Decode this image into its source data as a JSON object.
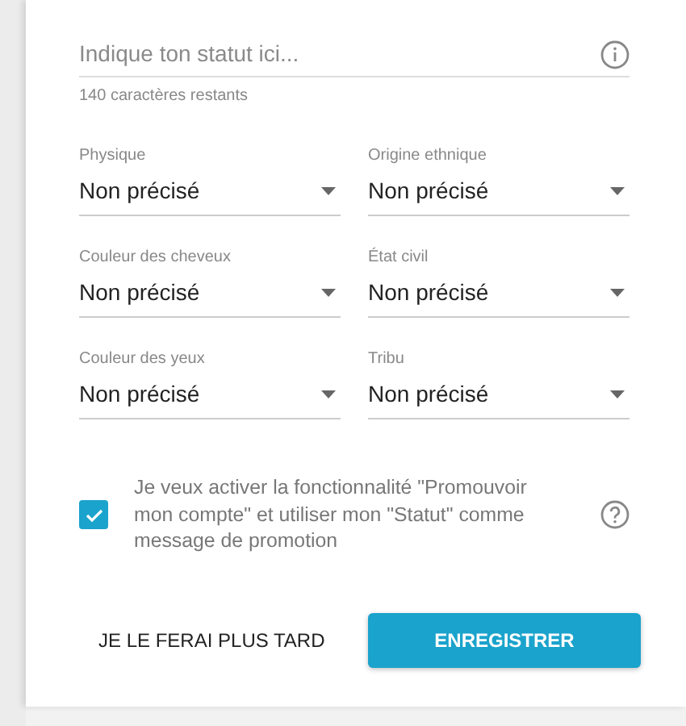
{
  "status": {
    "placeholder": "Indique ton statut ici...",
    "counter": "140 caractères restants"
  },
  "selects": [
    {
      "label": "Physique",
      "value": "Non précisé"
    },
    {
      "label": "Origine ethnique",
      "value": "Non précisé"
    },
    {
      "label": "Couleur des cheveux",
      "value": "Non précisé"
    },
    {
      "label": "État civil",
      "value": "Non précisé"
    },
    {
      "label": "Couleur des yeux",
      "value": "Non précisé"
    },
    {
      "label": "Tribu",
      "value": "Non précisé"
    }
  ],
  "promote": {
    "checked": true,
    "text": "Je veux activer la fonctionnalité \"Promouvoir mon compte\" et utiliser mon \"Statut\" comme message de promotion"
  },
  "buttons": [
    {
      "label": "JE LE FERAI PLUS TARD",
      "kind": "text"
    },
    {
      "label": "ENREGISTRER",
      "kind": "primary"
    }
  ]
}
